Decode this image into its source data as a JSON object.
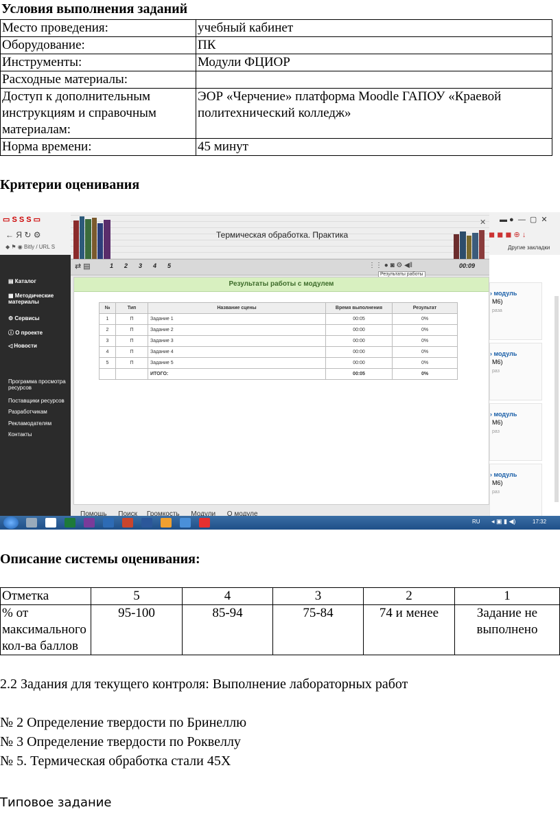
{
  "heading1": "Условия выполнения заданий",
  "conditions": [
    [
      "Место проведения:",
      "учебный кабинет"
    ],
    [
      "Оборудование:",
      "ПК"
    ],
    [
      "Инструменты:",
      "Модули ФЦИОР"
    ],
    [
      "Расходные материалы:",
      ""
    ],
    [
      "Доступ к дополнительным инструкциям и справочным материалам:",
      "ЭОР «Черчение» платформа Moodle  ГАПОУ «Краевой политехнический колледж»"
    ],
    [
      "Норма времени:",
      "45 минут"
    ]
  ],
  "heading2": "Критерии оценивания",
  "screenshot": {
    "window_title": "Термическая обработка. Практика",
    "address_text": "Bitly / URL S",
    "bookmarks_text": "Другие закладки",
    "tabs_numbers": [
      "1",
      "2",
      "3",
      "4",
      "5"
    ],
    "timer": "00:09",
    "tooltip": "Результаты работы",
    "panel_title": "Результаты работы с модулем",
    "table_headers": [
      "№",
      "Тип",
      "Название сцены",
      "Время выполнения",
      "Результат"
    ],
    "rows": [
      [
        "1",
        "П",
        "Задание 1",
        "00:05",
        "0%"
      ],
      [
        "2",
        "П",
        "Задание 2",
        "00:00",
        "0%"
      ],
      [
        "3",
        "П",
        "Задание 3",
        "00:00",
        "0%"
      ],
      [
        "4",
        "П",
        "Задание 4",
        "00:00",
        "0%"
      ],
      [
        "5",
        "П",
        "Задание 5",
        "00:00",
        "0%"
      ]
    ],
    "total": [
      "",
      "",
      "ИТОГО:",
      "00:05",
      "0%"
    ],
    "left_menu": [
      "Каталог",
      "Методические материалы",
      "Сервисы",
      "О проекте",
      "Новости"
    ],
    "left_links": [
      "Программа просмотра ресурсов",
      "Поставщики ресурсов",
      "Разработчикам",
      "Рекламодателям",
      "Контакты"
    ],
    "right_cards": [
      {
        "title": "› модуль",
        "sub": "М6)",
        "note": "раза"
      },
      {
        "title": "› модуль",
        "sub": "М6)",
        "note": "раз"
      },
      {
        "title": "› модуль",
        "sub": "М6)",
        "note": "раз"
      },
      {
        "title": "› модуль",
        "sub": "М6)",
        "note": "раз"
      }
    ],
    "bottom_menu": [
      "Помощь",
      "Поиск",
      "Громкость",
      "Модули",
      "О модуле"
    ],
    "tray_lang": "RU",
    "tray_time": "17:32"
  },
  "heading3": "Описание системы оценивания:",
  "grades": {
    "header": [
      "Отметка",
      "5",
      "4",
      "3",
      "2",
      "1"
    ],
    "row": [
      "% от максимального кол-ва баллов",
      "95-100",
      "85-94",
      "75-84",
      "74 и менее",
      "Задание не выполнено"
    ]
  },
  "line_task": "2.2 Задания для текущего контроля: Выполнение лабораторных работ",
  "labs": [
    "№ 2 Определение твердости по Бринеллю",
    "№ 3 Определение твердости по Роквеллу",
    "№ 5. Термическая обработка стали 45Х"
  ],
  "footer": "Типовое задание"
}
